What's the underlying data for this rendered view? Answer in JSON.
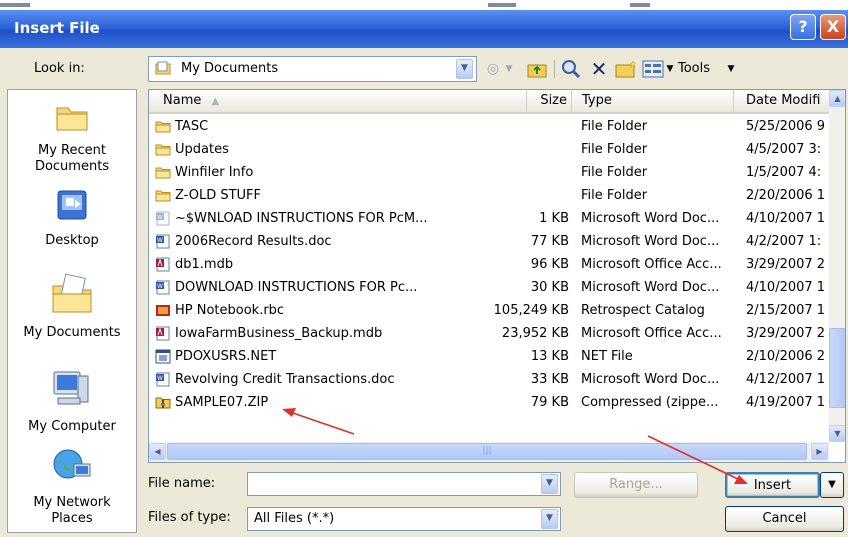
{
  "window": {
    "title": "Insert File",
    "help_glyph": "?",
    "close_glyph": "X"
  },
  "lookin": {
    "label": "Look in:",
    "value": "My Documents"
  },
  "toolbar": {
    "tools_label": "Tools"
  },
  "places": [
    {
      "label": "My Recent Documents",
      "icon": "recent-documents-icon"
    },
    {
      "label": "Desktop",
      "icon": "desktop-icon"
    },
    {
      "label": "My Documents",
      "icon": "my-documents-icon"
    },
    {
      "label": "My Computer",
      "icon": "my-computer-icon"
    },
    {
      "label": "My Network Places",
      "icon": "network-places-icon"
    }
  ],
  "columns": {
    "name": "Name",
    "size": "Size",
    "type": "Type",
    "date": "Date Modifi"
  },
  "files": [
    {
      "name": "TASC",
      "size": "",
      "type": "File Folder",
      "date": "5/25/2006 9",
      "icon": "folder"
    },
    {
      "name": "Updates",
      "size": "",
      "type": "File Folder",
      "date": "4/5/2007 3:",
      "icon": "folder"
    },
    {
      "name": "Winfiler Info",
      "size": "",
      "type": "File Folder",
      "date": "1/5/2007 4:",
      "icon": "folder"
    },
    {
      "name": "Z-OLD STUFF",
      "size": "",
      "type": "File Folder",
      "date": "2/20/2006 1",
      "icon": "folder"
    },
    {
      "name": "~$WNLOAD INSTRUCTIONS FOR PcM...",
      "size": "1 KB",
      "type": "Microsoft Word Doc...",
      "date": "4/10/2007 1",
      "icon": "word-temp"
    },
    {
      "name": "2006Record Results.doc",
      "size": "77 KB",
      "type": "Microsoft Word Doc...",
      "date": "4/2/2007 1:",
      "icon": "word"
    },
    {
      "name": "db1.mdb",
      "size": "96 KB",
      "type": "Microsoft Office Acc...",
      "date": "3/29/2007 2",
      "icon": "access"
    },
    {
      "name": "DOWNLOAD INSTRUCTIONS FOR Pc...",
      "size": "30 KB",
      "type": "Microsoft Word Doc...",
      "date": "4/10/2007 1",
      "icon": "word"
    },
    {
      "name": "HP Notebook.rbc",
      "size": "105,249 KB",
      "type": "Retrospect Catalog",
      "date": "2/15/2007 1",
      "icon": "retrospect"
    },
    {
      "name": "IowaFarmBusiness_Backup.mdb",
      "size": "23,952 KB",
      "type": "Microsoft Office Acc...",
      "date": "3/29/2007 2",
      "icon": "access"
    },
    {
      "name": "PDOXUSRS.NET",
      "size": "13 KB",
      "type": "NET File",
      "date": "2/10/2006 2",
      "icon": "net"
    },
    {
      "name": "Revolving Credit Transactions.doc",
      "size": "33 KB",
      "type": "Microsoft Word Doc...",
      "date": "4/12/2007 1",
      "icon": "word"
    },
    {
      "name": "SAMPLE07.ZIP",
      "size": "79 KB",
      "type": "Compressed (zippe...",
      "date": "4/19/2007 1",
      "icon": "zip"
    }
  ],
  "filename": {
    "label": "File name:",
    "value": ""
  },
  "filetype": {
    "label": "Files of type:",
    "value": "All Files (*.*)"
  },
  "buttons": {
    "range": "Range...",
    "insert": "Insert",
    "cancel": "Cancel"
  },
  "colors": {
    "title_bar": "#2d63d8",
    "annotation_arrow": "#e0302c",
    "dialog_bg": "#ece9d8"
  }
}
